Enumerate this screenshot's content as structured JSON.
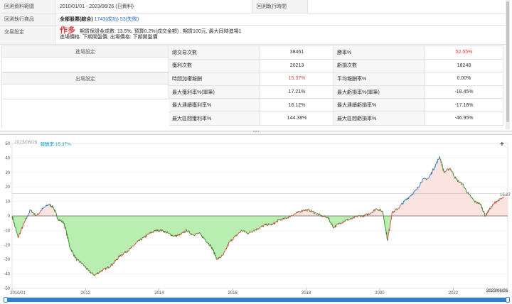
{
  "info": {
    "range_label": "回測資料範圍",
    "range_value": "2010/01/01 - 2023/06/26 (日資料)",
    "time_label": "回測執行時間",
    "target_label": "回測執行商品",
    "target_value": "全部股票(綜合)",
    "target_success": "1743(成功)",
    "target_fail": "53(失敗)",
    "trade_label": "交易設定",
    "trade_direction": "作多",
    "trade_line1": "期貨保證金成數: 13.5%, 預算0.2%(成交金額) , 期貨100元, 最大同時進場1",
    "trade_line2": "進場價格: 下期開盤價, 出場價格: 下期開盤價"
  },
  "settings": {
    "entry_label": "進場設定",
    "exit_label": "出場設定"
  },
  "stats": [
    {
      "l1": "總交易次數",
      "v1": "38461",
      "v1_red": false,
      "l2": "勝率%",
      "v2": "52.55%",
      "v2_red": true
    },
    {
      "l1": "獲利次數",
      "v1": "20213",
      "v1_red": false,
      "l2": "虧損次數",
      "v2": "18248",
      "v2_red": false
    },
    {
      "l1": "時間加權報酬",
      "v1": "15.37%",
      "v1_red": true,
      "l2": "平均報酬率%",
      "v2": "0.00%",
      "v2_red": false
    },
    {
      "l1": "最大獲利率%(單筆)",
      "v1": "17.21%",
      "v1_red": false,
      "l2": "最大虧損率%(單筆)",
      "v2": "-18.45%",
      "v2_red": false
    },
    {
      "l1": "最大連續獲利率%",
      "v1": "16.12%",
      "v1_red": false,
      "l2": "最大連續虧損率%",
      "v2": "-17.18%",
      "v2_red": false
    },
    {
      "l1": "最大區間獲利率%",
      "v1": "144.38%",
      "v1_red": false,
      "l2": "最大區間虧損率%",
      "v2": "-46.95%",
      "v2_red": false
    }
  ],
  "legend": {
    "date": "2023/06/26",
    "series_label": "報酬率:15.37%"
  },
  "end_value_label": "15.37",
  "end_date_label": "2023/06/26",
  "colors": {
    "up": "#e23a3a",
    "down": "#1f8a1f",
    "peak": "#2f6fd6",
    "negative_fill": "#b8eeb0",
    "positive_fill": "#fbe3e0",
    "accent": "#2e7fd4"
  },
  "chart_data": {
    "type": "area",
    "title": "",
    "xlabel": "",
    "ylabel": "",
    "ylim": [
      -50,
      50
    ],
    "yticks": [
      50,
      40,
      30,
      20,
      10,
      0,
      -10,
      -20,
      -30,
      -40,
      -50
    ],
    "xlim": [
      "2010/01/01",
      "2023/06/26"
    ],
    "xticks": [
      "2010/01",
      "2012",
      "2014",
      "2016",
      "2018",
      "2020",
      "2022"
    ],
    "grid": true,
    "reference_line": 15.37,
    "series": [
      {
        "x": [
          "2010/01/01",
          "2010/03/01",
          "2010/05/01",
          "2010/07/01",
          "2010/09/01",
          "2010/11/01",
          "2011/01/01",
          "2011/02/15",
          "2011/04/01",
          "2011/06/01",
          "2011/08/01",
          "2011/10/01",
          "2011/12/01",
          "2012/02/01",
          "2012/04/01",
          "2012/06/01",
          "2012/08/01",
          "2012/10/01",
          "2012/12/01",
          "2013/02/01",
          "2013/04/01",
          "2013/06/01",
          "2013/08/01",
          "2013/10/01",
          "2013/12/01",
          "2014/02/01",
          "2014/04/01",
          "2014/06/01",
          "2014/08/01",
          "2014/10/01",
          "2014/12/01",
          "2015/02/01",
          "2015/04/01",
          "2015/06/01",
          "2015/08/01",
          "2015/10/01",
          "2015/12/01",
          "2016/02/01",
          "2016/04/01",
          "2016/06/01",
          "2016/08/01",
          "2016/10/01",
          "2016/12/01",
          "2017/02/01",
          "2017/04/01",
          "2017/06/01",
          "2017/08/01",
          "2017/10/01",
          "2017/12/01",
          "2018/02/01",
          "2018/04/01",
          "2018/06/01",
          "2018/08/01",
          "2018/10/01",
          "2018/12/01",
          "2019/02/01",
          "2019/04/01",
          "2019/06/01",
          "2019/08/01",
          "2019/10/01",
          "2019/12/01",
          "2020/02/01",
          "2020/03/20",
          "2020/05/01",
          "2020/07/01",
          "2020/09/01",
          "2020/11/01",
          "2021/01/01",
          "2021/03/01",
          "2021/05/01",
          "2021/07/01",
          "2021/08/20",
          "2021/10/01",
          "2021/12/01",
          "2022/02/01",
          "2022/04/01",
          "2022/06/01",
          "2022/08/01",
          "2022/10/01",
          "2022/11/15",
          "2023/01/01",
          "2023/03/01",
          "2023/05/01",
          "2023/06/26"
        ],
        "values": [
          0,
          -15,
          -5,
          4,
          0,
          5,
          8,
          6,
          -2,
          -5,
          -22,
          -30,
          -33,
          -38,
          -41,
          -38,
          -36,
          -33,
          -28,
          -25,
          -22,
          -18,
          -15,
          -12,
          -10,
          -10,
          -12,
          -14,
          -13,
          -10,
          -13,
          -12,
          -16,
          -21,
          -30,
          -27,
          -18,
          -14,
          -10,
          -12,
          -10,
          -8,
          -6,
          -6,
          -3,
          -2,
          0,
          2,
          4,
          4,
          2,
          0,
          -1,
          -8,
          -5,
          -3,
          -2,
          0,
          0,
          2,
          5,
          3,
          -17,
          2,
          5,
          10,
          14,
          18,
          25,
          26,
          34,
          41,
          30,
          33,
          25,
          22,
          15,
          10,
          8,
          0,
          5,
          10,
          12,
          15.37
        ]
      }
    ]
  }
}
